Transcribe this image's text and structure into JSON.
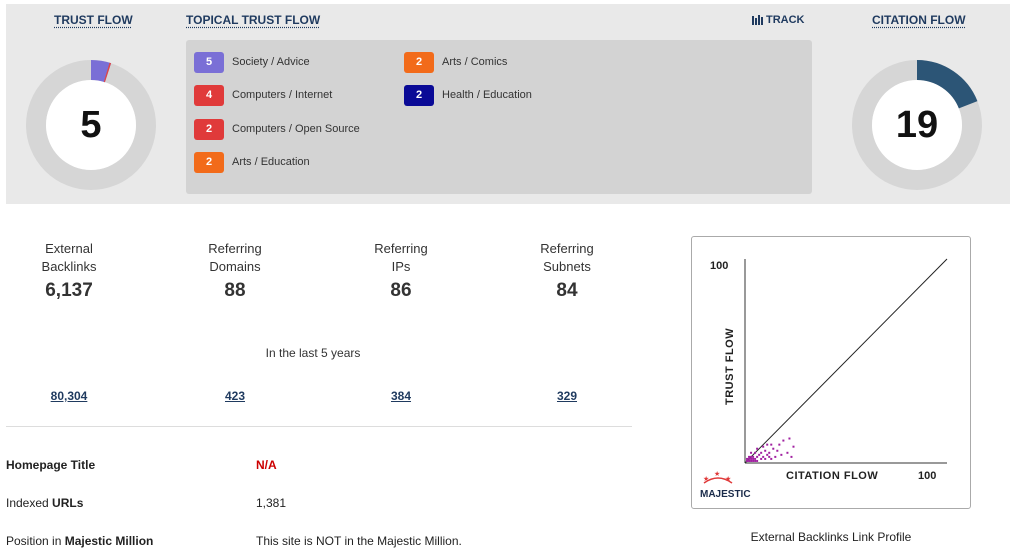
{
  "header": {
    "trust_flow_title": "TRUST FLOW",
    "topical_trust_flow_title": "TOPICAL TRUST FLOW",
    "track_label": "TRACK",
    "citation_flow_title": "CITATION FLOW"
  },
  "trust_flow": {
    "value": "5",
    "level": 5,
    "color": "#7a6fd6",
    "accent": "#e04646"
  },
  "citation_flow": {
    "value": "19",
    "level": 19,
    "color": "#2c5576"
  },
  "topical_trust_flow": [
    {
      "value": "5",
      "label": "Society / Advice",
      "color": "#7a6fd6"
    },
    {
      "value": "4",
      "label": "Computers / Internet",
      "color": "#e03a3a"
    },
    {
      "value": "2",
      "label": "Computers / Open Source",
      "color": "#e03a3a"
    },
    {
      "value": "2",
      "label": "Arts / Education",
      "color": "#f26b1a"
    },
    {
      "value": "2",
      "label": "Arts / Comics",
      "color": "#f26b1a"
    },
    {
      "value": "2",
      "label": "Health / Education",
      "color": "#0a0a96"
    }
  ],
  "stats": [
    {
      "label_line1": "External",
      "label_line2": "Backlinks",
      "value": "6,137",
      "history": "80,304"
    },
    {
      "label_line1": "Referring",
      "label_line2": "Domains",
      "value": "88",
      "history": "423"
    },
    {
      "label_line1": "Referring",
      "label_line2": "IPs",
      "value": "86",
      "history": "384"
    },
    {
      "label_line1": "Referring",
      "label_line2": "Subnets",
      "value": "84",
      "history": "329"
    }
  ],
  "period_text": "In the last 5 years",
  "info": {
    "homepage_title_label": "Homepage Title",
    "homepage_title_value": "N/A",
    "indexed_urls_label_prefix": "Indexed ",
    "indexed_urls_label_bold": "URLs",
    "indexed_urls_value": "1,381",
    "position_label_prefix": "Position in ",
    "position_label_bold": "Majestic Million",
    "position_value": "This site is NOT in the Majestic Million."
  },
  "chart_data": {
    "type": "scatter",
    "title": "",
    "xlabel": "CITATION FLOW",
    "ylabel": "TRUST FLOW",
    "xlim": [
      0,
      100
    ],
    "ylim": [
      0,
      100
    ],
    "x_max_label": "100",
    "y_max_label": "100",
    "logo_text": "MAJESTIC",
    "caption": "External Backlinks Link Profile",
    "point_color": "#a020a0",
    "points": [
      [
        1,
        1
      ],
      [
        2,
        1
      ],
      [
        3,
        1
      ],
      [
        4,
        1
      ],
      [
        5,
        1
      ],
      [
        6,
        1
      ],
      [
        1,
        2
      ],
      [
        2,
        2
      ],
      [
        3,
        2
      ],
      [
        4,
        2
      ],
      [
        5,
        2
      ],
      [
        2,
        3
      ],
      [
        3,
        3
      ],
      [
        4,
        3
      ],
      [
        6,
        3
      ],
      [
        8,
        2
      ],
      [
        9,
        3
      ],
      [
        10,
        2
      ],
      [
        11,
        4
      ],
      [
        12,
        3
      ],
      [
        13,
        2
      ],
      [
        8,
        5
      ],
      [
        10,
        6
      ],
      [
        12,
        5
      ],
      [
        14,
        7
      ],
      [
        16,
        6
      ],
      [
        13,
        9
      ],
      [
        17,
        9
      ],
      [
        19,
        11
      ],
      [
        22,
        12
      ],
      [
        24,
        8
      ],
      [
        21,
        5
      ],
      [
        18,
        4
      ],
      [
        15,
        3
      ],
      [
        23,
        3
      ],
      [
        7,
        4
      ],
      [
        5,
        5
      ],
      [
        3,
        5
      ],
      [
        6,
        7
      ],
      [
        9,
        8
      ],
      [
        11,
        9
      ]
    ],
    "line": [
      [
        0,
        0
      ],
      [
        100,
        100
      ]
    ]
  }
}
